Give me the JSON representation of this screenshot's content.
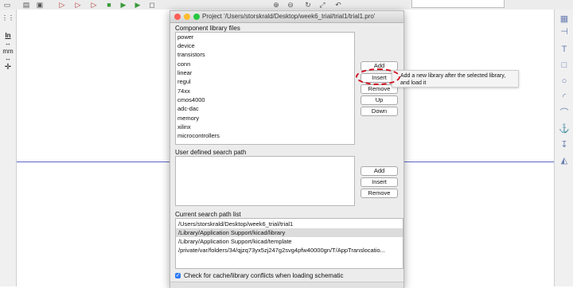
{
  "dialog": {
    "title": "Project '/Users/storskrald/Desktop/week6_trial/trial1/trial1.pro'",
    "component_library_label": "Component library files",
    "libraries": [
      "power",
      "device",
      "transistors",
      "conn",
      "linear",
      "regul",
      "74xx",
      "cmos4000",
      "adc-dac",
      "memory",
      "xilinx",
      "microcontrollers"
    ],
    "library_buttons": {
      "add": "Add",
      "insert": "Insert",
      "remove": "Remove",
      "up": "Up",
      "down": "Down"
    },
    "user_path_label": "User defined search path",
    "user_path_buttons": {
      "add": "Add",
      "insert": "Insert",
      "remove": "Remove"
    },
    "current_path_label": "Current search path list",
    "search_paths": [
      "/Users/storskrald/Desktop/week6_trial/trial1",
      "/Library/Application Support/kicad/library",
      "/Library/Application Support/kicad/template",
      "/private/var/folders/34/qjzq73yx5zj247g2svg4pfw40000gn/T/AppTranslocatio..."
    ],
    "selected_search_path_index": 1,
    "check_label": "Check for cache/library conflicts when loading schematic",
    "check_checked": true
  },
  "tooltip": {
    "text": "Add a new library after the selected library, and load it"
  },
  "left_toolbar": {
    "units_in": "In",
    "units_mm": "mm"
  },
  "colors": {
    "accent": "#2f7cf6",
    "highlight": "#d10f1f",
    "sheet_line": "#5b66c9"
  },
  "icons": [
    "new-icon",
    "open-icon",
    "save-icon",
    "zoom-in-icon",
    "zoom-out-icon",
    "redraw-icon",
    "grid-icon",
    "cursor-icon",
    "text-icon",
    "rectangle-icon",
    "circle-icon",
    "arc-icon",
    "anchor-icon"
  ]
}
